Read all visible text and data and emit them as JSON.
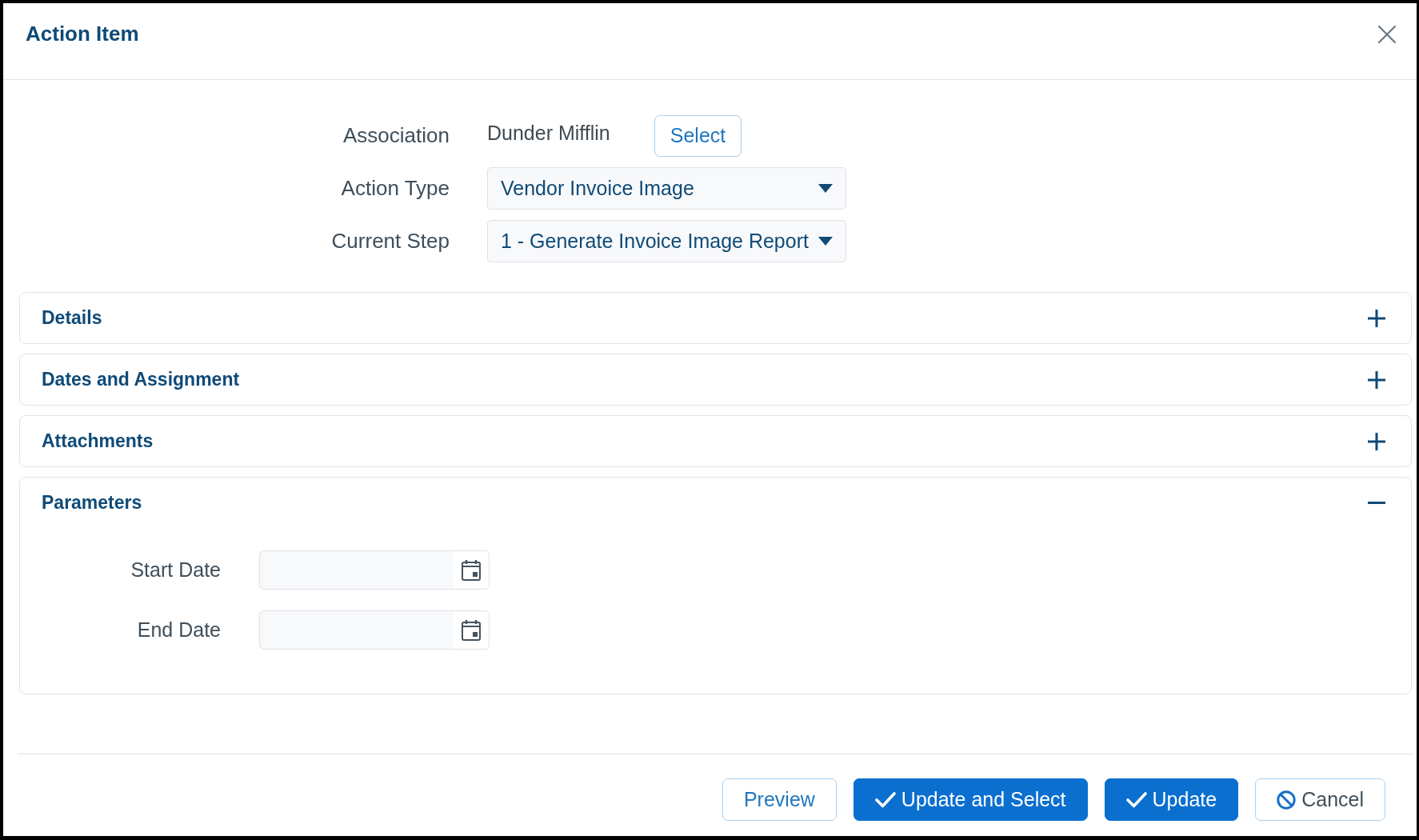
{
  "dialog": {
    "title": "Action Item"
  },
  "fields": [
    {
      "kind": "association",
      "label": "Association",
      "value": "Dunder Mifflin",
      "button": "Select"
    },
    {
      "kind": "dropdown",
      "label": "Action Type",
      "value": "Vendor Invoice Image"
    },
    {
      "kind": "dropdown",
      "label": "Current Step",
      "value": "1 - Generate Invoice Image Report"
    }
  ],
  "sections": [
    {
      "title": "Details",
      "expanded": false
    },
    {
      "title": "Dates and Assignment",
      "expanded": false
    },
    {
      "title": "Attachments",
      "expanded": false
    },
    {
      "title": "Parameters",
      "expanded": true,
      "fields": [
        {
          "kind": "date",
          "label": "Start Date"
        },
        {
          "kind": "date",
          "label": "End Date"
        }
      ]
    }
  ],
  "buttons": [
    {
      "kind": "secondary",
      "label": "Preview"
    },
    {
      "kind": "confirm",
      "label": "Update and Select"
    },
    {
      "kind": "confirm",
      "label": "Update"
    },
    {
      "kind": "cancel",
      "label": "Cancel"
    }
  ]
}
